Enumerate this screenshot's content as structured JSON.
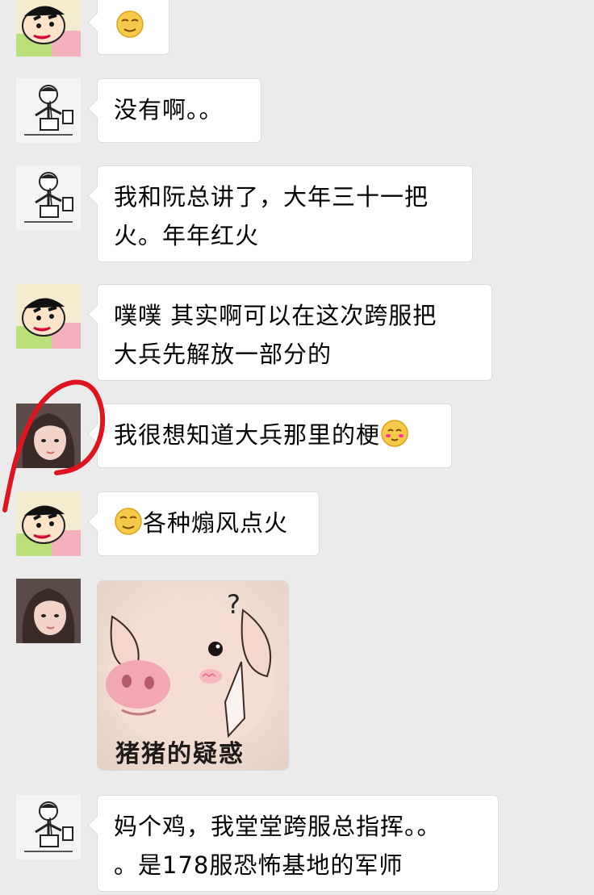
{
  "messages": [
    {
      "sender": "crayon-shin-chan",
      "type": "emoji"
    },
    {
      "sender": "stick-figure",
      "type": "text",
      "text": "没有啊。。"
    },
    {
      "sender": "stick-figure",
      "type": "text",
      "text": "我和阮总讲了，大年三十一把\n火。年年红火"
    },
    {
      "sender": "crayon-shin-chan",
      "type": "text",
      "text": "噗噗  其实啊可以在这次跨服把\n大兵先解放一部分的"
    },
    {
      "sender": "girl",
      "type": "text",
      "text": "我很想知道大兵那里的梗"
    },
    {
      "sender": "crayon-shin-chan",
      "type": "text",
      "text": "各种煽风点火"
    },
    {
      "sender": "girl",
      "type": "sticker",
      "caption": "猪猪的疑惑",
      "mark": "?"
    },
    {
      "sender": "stick-figure",
      "type": "text",
      "text": "妈个鸡，我堂堂跨服总指挥。。\n。是178服恐怖基地的军师"
    }
  ],
  "colors": {
    "background": "#ebebeb",
    "bubble": "#ffffff",
    "annotation": "#e0141e"
  }
}
